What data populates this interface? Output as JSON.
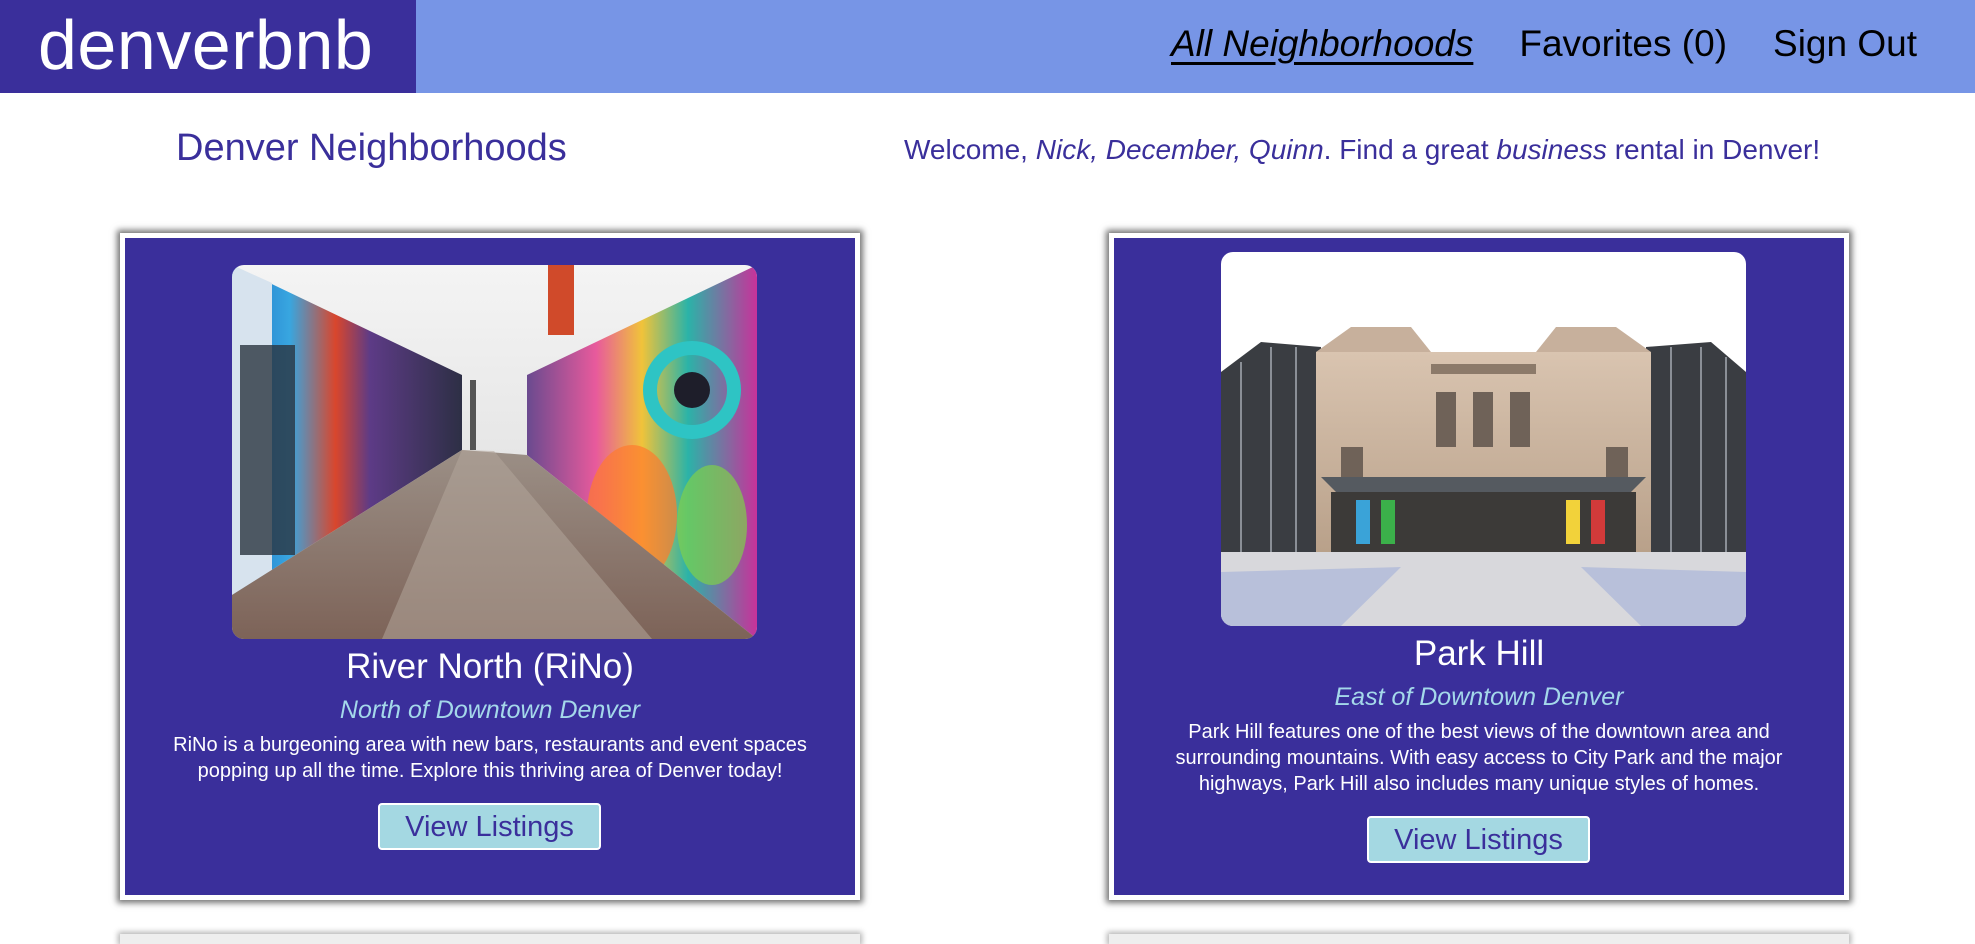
{
  "header": {
    "logo": "denverbnb",
    "nav": [
      "All Neighborhoods",
      "Favorites (0)",
      "Sign Out"
    ]
  },
  "page": {
    "heading": "Denver Neighborhoods",
    "welcome": {
      "prefix": "Welcome, ",
      "names": "Nick, December, Quinn",
      "middle": ". Find a great ",
      "purpose": "business",
      "suffix": " rental in Denver!"
    }
  },
  "cards": [
    {
      "title": "River North (RiNo)",
      "subtitle": "North of Downtown Denver",
      "description": "RiNo is a burgeoning area with new bars, restaurants and event spaces popping up all the time. Explore this thriving area of Denver today!",
      "button": "View Listings",
      "image_icon": "graffiti-alley-photo"
    },
    {
      "title": "Park Hill",
      "subtitle": "East of Downtown Denver",
      "description": "Park Hill features one of the best views of the downtown area and surrounding mountains. With easy access to City Park and the major highways, Park Hill also includes many unique styles of homes.",
      "button": "View Listings",
      "image_icon": "museum-building-photo"
    }
  ],
  "colors": {
    "brand_dark": "#3a2f9b",
    "nav_bar": "#7795e6",
    "accent_light": "#a4d8e2",
    "subtitle": "#a4d8ea"
  }
}
